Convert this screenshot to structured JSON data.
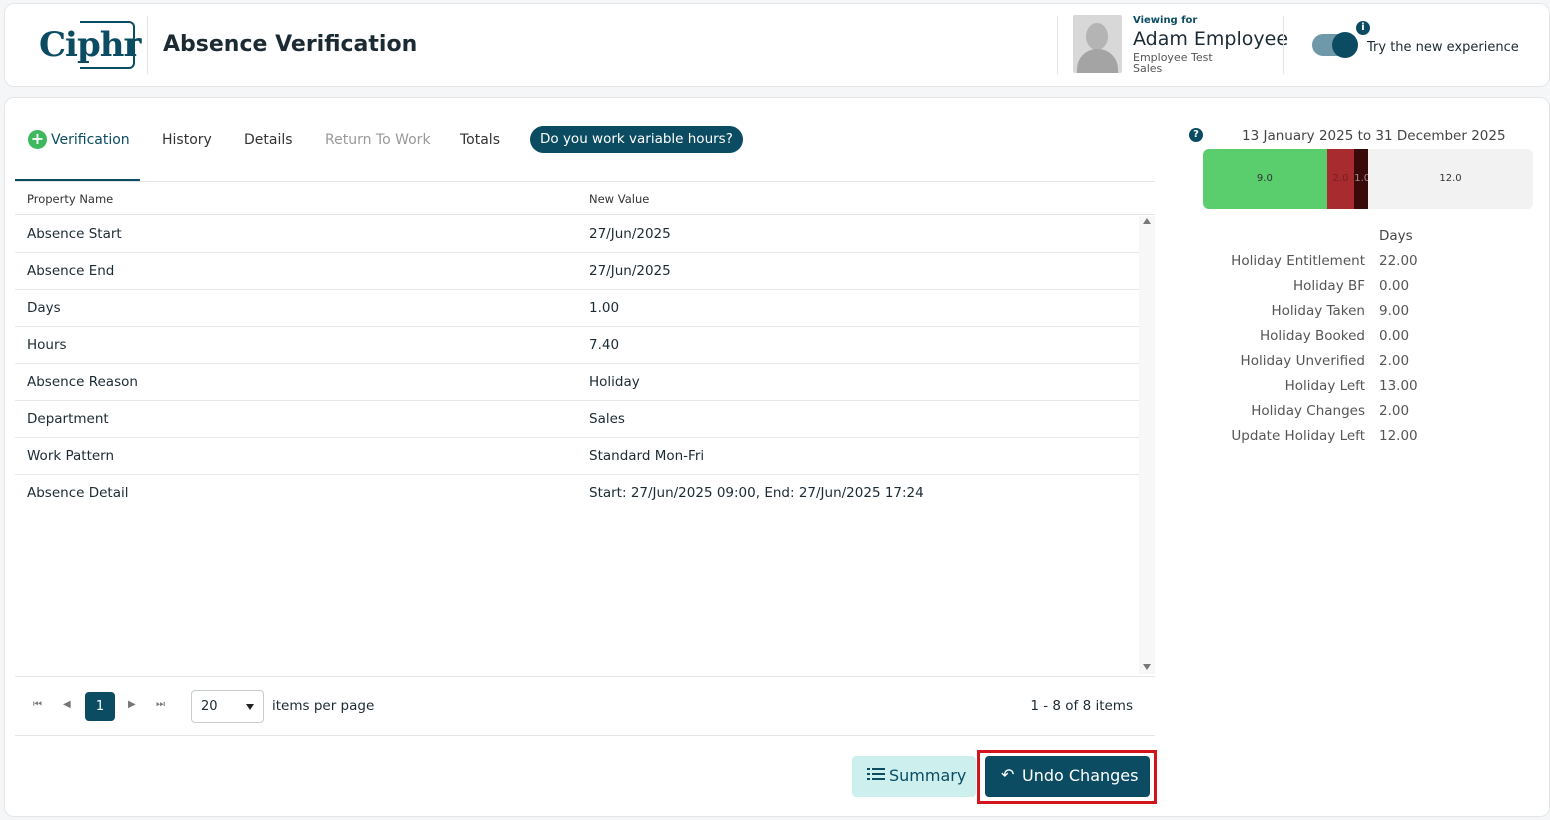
{
  "header": {
    "logo_text": "Ciphr",
    "page_title": "Absence Verification",
    "viewing_label": "Viewing for",
    "employee_name": "Adam Employee",
    "employee_role": "Employee Test",
    "employee_dept": "Sales",
    "toggle_label": "Try the new experience",
    "info_icon": "i"
  },
  "tabs": [
    {
      "label": "Verification",
      "active": true
    },
    {
      "label": "History"
    },
    {
      "label": "Details"
    },
    {
      "label": "Return To Work",
      "disabled": true
    },
    {
      "label": "Totals"
    }
  ],
  "variable_hours_button": "Do you work variable hours?",
  "grid": {
    "columns": [
      "Property Name",
      "New Value"
    ],
    "rows": [
      [
        "Absence Start",
        "27/Jun/2025"
      ],
      [
        "Absence End",
        "27/Jun/2025"
      ],
      [
        "Days",
        "1.00"
      ],
      [
        "Hours",
        "7.40"
      ],
      [
        "Absence Reason",
        "Holiday"
      ],
      [
        "Department",
        "Sales"
      ],
      [
        "Work Pattern",
        "Standard Mon-Fri"
      ],
      [
        "Absence Detail",
        "Start: 27/Jun/2025 09:00, End: 27/Jun/2025 17:24"
      ]
    ]
  },
  "pager": {
    "current_page": "1",
    "page_size": "20",
    "items_label": "items per page",
    "info": "1 - 8 of 8 items"
  },
  "buttons": {
    "summary": "Summary",
    "undo": "Undo Changes"
  },
  "holiday_panel": {
    "help_icon": "?",
    "date_range": "13 January 2025 to 31 December 2025",
    "bar_segments": [
      {
        "label": "9.0",
        "value": 9.0,
        "color": "#5acd6c",
        "text_color": "#333333"
      },
      {
        "label": "2.0",
        "value": 2.0,
        "color": "#a72b2f",
        "text_color": "#7a1e20"
      },
      {
        "label": "1.0",
        "value": 1.0,
        "color": "#3a0a0a",
        "text_color": "#a89090"
      },
      {
        "label": "12.0",
        "value": 12.0,
        "color": "#f2f2f2",
        "text_color": "#333333"
      }
    ],
    "column_header": "Days",
    "rows": [
      {
        "label": "Holiday Entitlement",
        "value": "22.00"
      },
      {
        "label": "Holiday BF",
        "value": "0.00"
      },
      {
        "label": "Holiday Taken",
        "value": "9.00"
      },
      {
        "label": "Holiday Booked",
        "value": "0.00"
      },
      {
        "label": "Holiday Unverified",
        "value": "2.00"
      },
      {
        "label": "Holiday Left",
        "value": "13.00"
      },
      {
        "label": "Holiday Changes",
        "value": "2.00"
      },
      {
        "label": "Update Holiday Left",
        "value": "12.00"
      }
    ]
  }
}
